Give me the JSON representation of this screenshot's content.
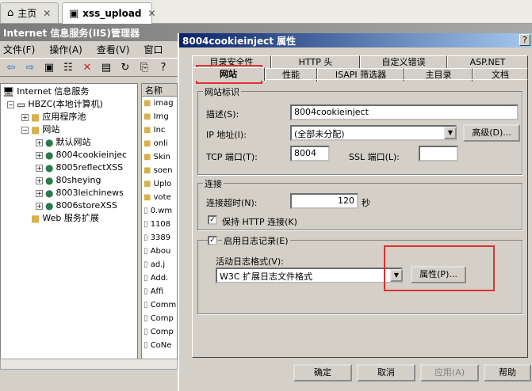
{
  "browser": {
    "tabs": [
      {
        "label": "主页",
        "icon": "home-icon"
      },
      {
        "label": "xss_upload",
        "icon": "vm-icon"
      }
    ]
  },
  "mmc": {
    "title": "Internet 信息服务(IIS)管理器",
    "menu": [
      "文件(F)",
      "操作(A)",
      "查看(V)",
      "窗口"
    ],
    "tree": [
      {
        "label": "Internet 信息服务",
        "level": 0
      },
      {
        "label": "HBZC(本地计算机)",
        "level": 1
      },
      {
        "label": "应用程序池",
        "level": 2
      },
      {
        "label": "网站",
        "level": 2
      },
      {
        "label": "默认网站",
        "level": 3
      },
      {
        "label": "8004cookieinjec",
        "level": 3
      },
      {
        "label": "8005reflectXSS",
        "level": 3
      },
      {
        "label": "80sheying",
        "level": 3
      },
      {
        "label": "8003leichinews",
        "level": 3
      },
      {
        "label": "8006storeXSS",
        "level": 3
      },
      {
        "label": "Web 服务扩展",
        "level": 2
      }
    ],
    "list_header": "名称",
    "list_items": [
      "imag",
      "Img",
      "Inc",
      "onli",
      "Skin",
      "soen",
      "Uplo",
      "vote",
      "0.wm",
      "1108",
      "3389",
      "Abou",
      "ad.j",
      "Add.",
      "Affi",
      "Comm",
      "Comp",
      "Comp",
      "CoNe"
    ]
  },
  "dialog": {
    "title": "8004cookieinject 属性",
    "help": "?",
    "tabs_row1": [
      "目录安全性",
      "HTTP 头",
      "自定义错误",
      "ASP.NET"
    ],
    "tabs_row2": [
      "网站",
      "性能",
      "ISAPI 筛选器",
      "主目录",
      "文档"
    ],
    "group_site": "网站标识",
    "desc_label": "描述(S):",
    "desc_value": "8004cookieinject",
    "ip_label": "IP 地址(I):",
    "ip_value": "(全部未分配)",
    "advanced_btn": "高级(D)...",
    "tcp_label": "TCP 端口(T):",
    "tcp_value": "8004",
    "ssl_label": "SSL 端口(L):",
    "ssl_value": "",
    "group_conn": "连接",
    "timeout_label": "连接超时(N):",
    "timeout_value": "120",
    "timeout_unit": "秒",
    "keepalive_label": "保持 HTTP 连接(K)",
    "log_enable_label": "启用日志记录(E)",
    "log_format_label": "活动日志格式(V):",
    "log_format_value": "W3C 扩展日志文件格式",
    "props_btn": "属性(P)...",
    "ok_btn": "确定",
    "cancel_btn": "取消",
    "apply_btn": "应用(A)",
    "help_btn": "帮助"
  }
}
